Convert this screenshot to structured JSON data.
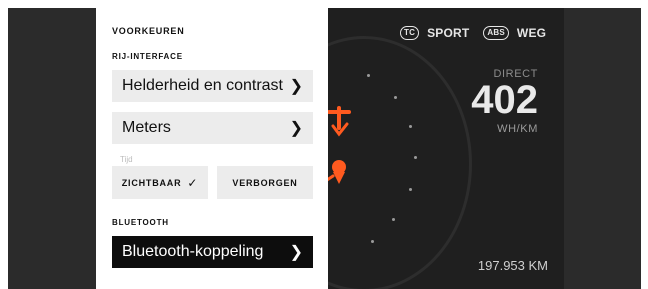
{
  "preferences": {
    "title": "VOORKEUREN",
    "ride_interface_label": "RIJ-INTERFACE",
    "brightness_contrast_label": "Helderheid en contrast",
    "meters_label": "Meters",
    "time_label": "Tijd",
    "visible_label": "ZICHTBAAR",
    "hidden_label": "VERBORGEN",
    "bluetooth_section_label": "BLUETOOTH",
    "bluetooth_pairing_label": "Bluetooth-koppeling"
  },
  "dashboard": {
    "tc_badge": "TC",
    "mode_label": "SPORT",
    "abs_badge": "ABS",
    "road_label": "WEG",
    "direct_label": "DIRECT",
    "direct_value": "402",
    "direct_unit": "WH/KM",
    "odometer": "197.953 KM"
  },
  "colors": {
    "accent": "#ff5a1f",
    "panel_bg": "#ffffff",
    "dash_bg": "#1f1f1f"
  },
  "icons": {
    "chevron": "chevron-right-icon",
    "check": "check-icon",
    "warning": "warning-icon"
  }
}
